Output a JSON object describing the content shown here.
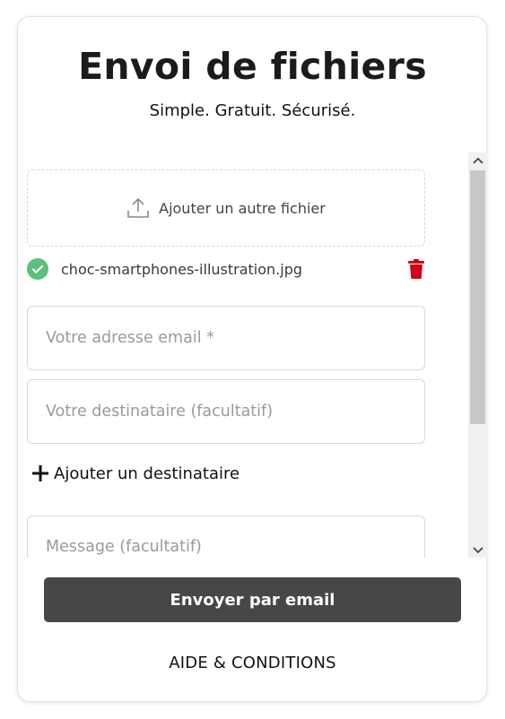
{
  "header": {
    "title": "Envoi de fichiers",
    "subtitle": "Simple. Gratuit. Sécurisé."
  },
  "upload": {
    "add_file_label": "Ajouter un autre fichier",
    "icon": "upload-icon"
  },
  "files": [
    {
      "name": "choc-smartphones-illustration.jpg",
      "status_icon": "check-circle-icon",
      "status_color": "#5cc07d",
      "delete_icon": "trash-icon",
      "delete_color": "#d0021b"
    }
  ],
  "form": {
    "email_placeholder": "Votre adresse email *",
    "recipient_placeholder": "Votre destinataire (facultatif)",
    "add_recipient_label": "Ajouter un destinataire",
    "message_placeholder": "Message (facultatif)"
  },
  "actions": {
    "send_label": "Envoyer par email",
    "send_color": "#474747",
    "help_label": "AIDE & CONDITIONS"
  }
}
